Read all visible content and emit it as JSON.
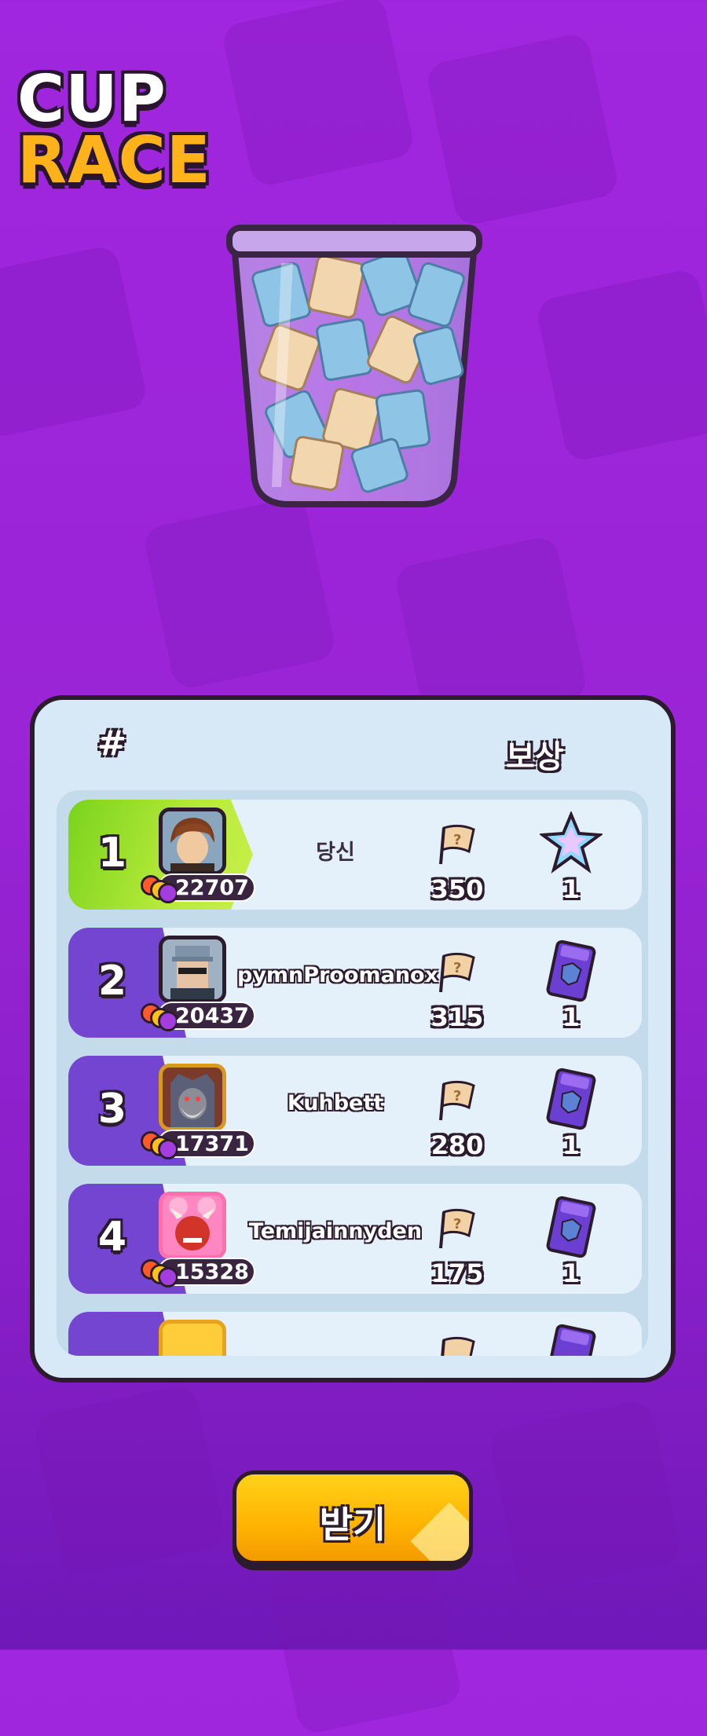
{
  "event": {
    "title_line1": "CUP",
    "title_line2": "RACE"
  },
  "leaderboard": {
    "col_rank": "#",
    "col_reward": "보상",
    "rows": [
      {
        "rank": "1",
        "name": "당신",
        "trophies": "22707",
        "score": "350",
        "reward_count": "1",
        "reward_icon": "crystal-star-icon",
        "is_me": true
      },
      {
        "rank": "2",
        "name": "pymnProomanox",
        "trophies": "20437",
        "score": "315",
        "reward_count": "1",
        "reward_icon": "card-pack-icon",
        "is_me": false
      },
      {
        "rank": "3",
        "name": "Kuhbett",
        "trophies": "17371",
        "score": "280",
        "reward_count": "1",
        "reward_icon": "card-pack-icon",
        "is_me": false
      },
      {
        "rank": "4",
        "name": "Temijainnyden",
        "trophies": "15328",
        "score": "175",
        "reward_count": "1",
        "reward_icon": "card-pack-icon",
        "is_me": false
      }
    ]
  },
  "claim_button": {
    "label": "받기"
  },
  "colors": {
    "background": "#9a24d6",
    "panel": "#d7e9f6",
    "highlight_row": "#9de02e",
    "rank_badge": "#7345d0",
    "button": "#ffb300"
  }
}
